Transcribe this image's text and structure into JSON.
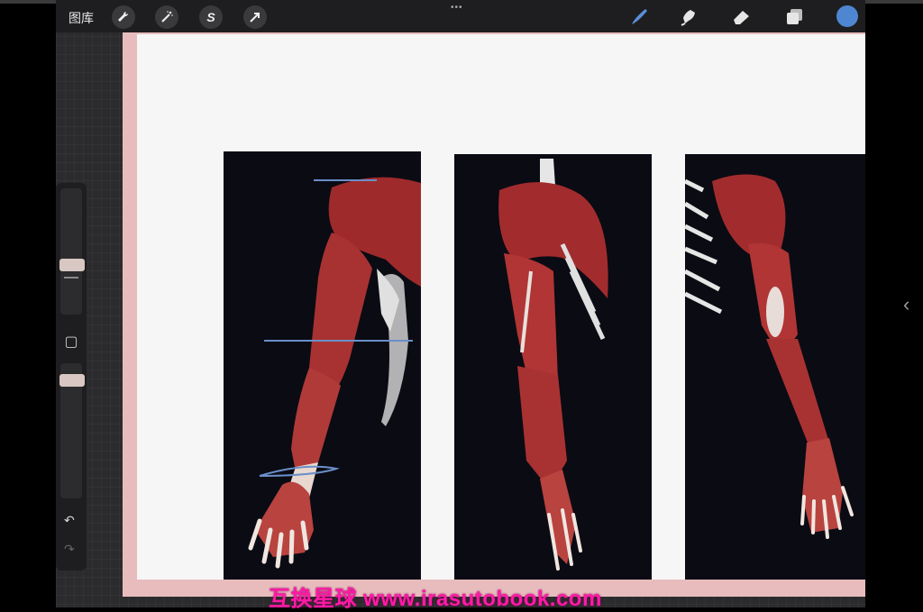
{
  "toolbar": {
    "gallery_label": "图库",
    "actions": [
      {
        "name": "actions-button",
        "icon": "wrench-icon"
      },
      {
        "name": "adjustments-button",
        "icon": "magic-wand-icon"
      },
      {
        "name": "selection-button",
        "icon": "selection-s-icon",
        "glyph": "S"
      },
      {
        "name": "transform-button",
        "icon": "arrow-cursor-icon"
      }
    ],
    "handle": "•••",
    "right_tools": [
      "brush-icon",
      "smudge-icon",
      "eraser-icon",
      "layers-icon"
    ],
    "color_hex": "#4f86d1"
  },
  "sidebar": {
    "undo_glyph": "↶",
    "redo_glyph": "↷",
    "modify_glyph": "▢"
  },
  "canvas": {
    "frame_color": "#e8bcbd",
    "paper_color": "#f6f6f6"
  },
  "watermark": "互换星球 www.irasutobook.com",
  "edge": {
    "chevron": "‹"
  }
}
